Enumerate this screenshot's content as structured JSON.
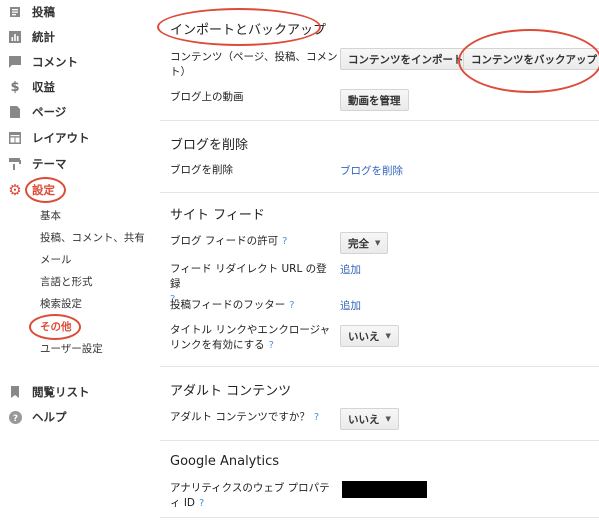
{
  "sidebar": {
    "items": [
      {
        "label": "投稿",
        "icon": "posts-icon"
      },
      {
        "label": "統計",
        "icon": "stats-icon"
      },
      {
        "label": "コメント",
        "icon": "comment-icon"
      },
      {
        "label": "収益",
        "icon": "dollar-icon"
      },
      {
        "label": "ページ",
        "icon": "page-icon"
      },
      {
        "label": "レイアウト",
        "icon": "layout-icon"
      },
      {
        "label": "テーマ",
        "icon": "theme-icon"
      },
      {
        "label": "設定",
        "icon": "gear-icon",
        "active": true
      },
      {
        "label": "閲覧リスト",
        "icon": "bookmark-icon"
      },
      {
        "label": "ヘルプ",
        "icon": "help-icon"
      }
    ],
    "settings_subitems": [
      {
        "label": "基本"
      },
      {
        "label": "投稿、コメント、共有"
      },
      {
        "label": "メール"
      },
      {
        "label": "言語と形式"
      },
      {
        "label": "検索設定"
      },
      {
        "label": "その他",
        "active": true
      },
      {
        "label": "ユーザー設定"
      }
    ],
    "accent_color": "#dd4b39"
  },
  "main": {
    "import_backup": {
      "title": "インポートとバックアップ",
      "content_label": "コンテンツ（ページ、投稿、コメント）",
      "import_button": "コンテンツをインポート",
      "backup_button": "コンテンツをバックアップ",
      "video_label": "ブログ上の動画",
      "video_button": "動画を管理"
    },
    "delete_blog": {
      "title": "ブログを削除",
      "label": "ブログを削除",
      "link": "ブログを削除"
    },
    "site_feed": {
      "title": "サイト フィード",
      "allow_label": "ブログ フィードの許可",
      "allow_value": "完全",
      "redirect_label": "フィード リダイレクト URL の登録",
      "redirect_link": "追加",
      "footer_label": "投稿フィードのフッター",
      "footer_link": "追加",
      "title_links_label": "タイトル リンクやエンクロージャ リンクを有効にする",
      "title_links_value": "いいえ"
    },
    "adult": {
      "title": "アダルト コンテンツ",
      "label": "アダルト コンテンツですか？",
      "value": "いいえ"
    },
    "analytics": {
      "title": "Google Analytics",
      "label": "アナリティクスのウェブ プロパティ ID"
    },
    "help_mark": "?",
    "link_color": "#3366bb"
  }
}
